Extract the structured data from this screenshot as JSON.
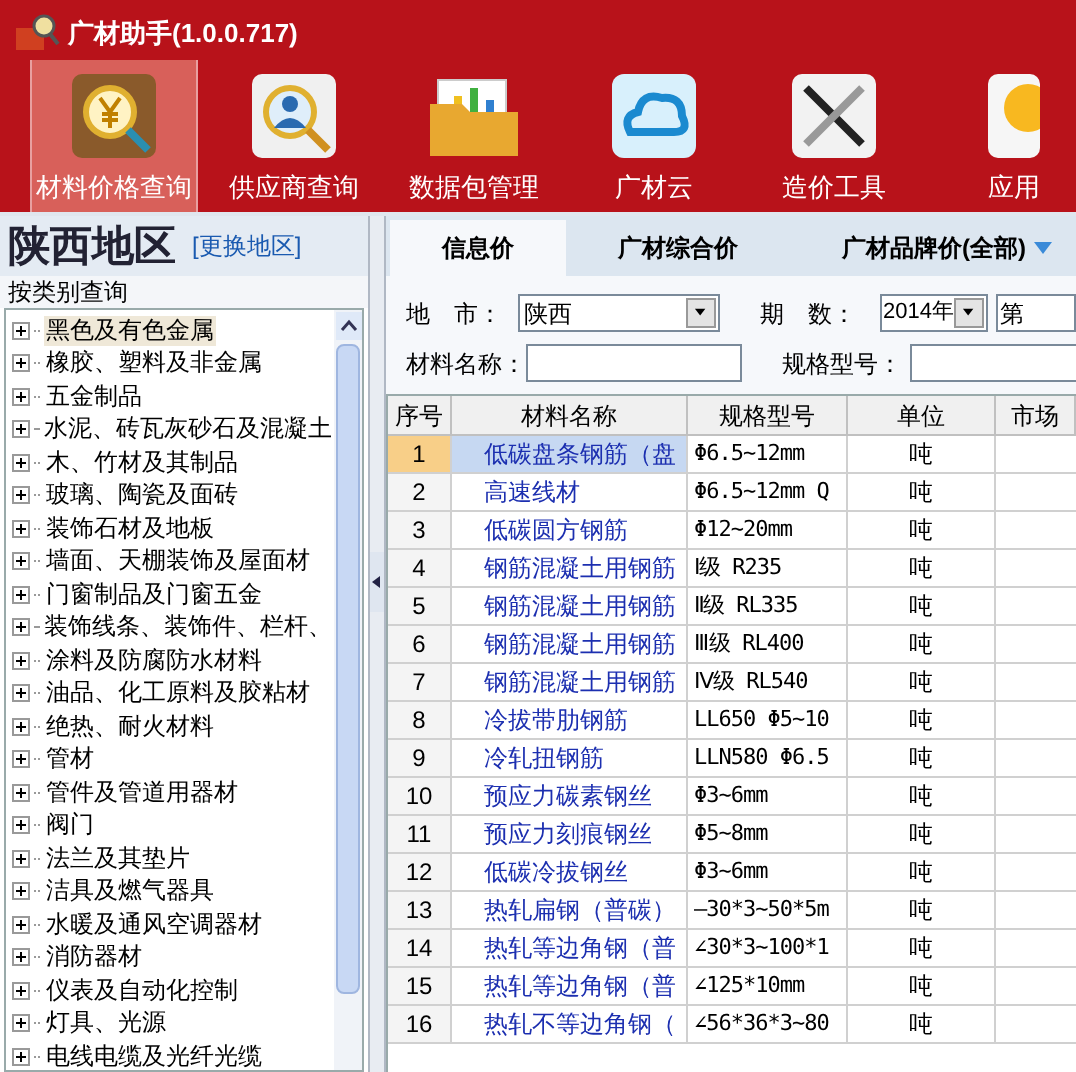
{
  "window": {
    "title": "广材助手(1.0.0.717)"
  },
  "toolbar": [
    {
      "label": "材料价格查询",
      "kind": "price",
      "selected": true
    },
    {
      "label": "供应商查询",
      "kind": "supplier",
      "selected": false
    },
    {
      "label": "数据包管理",
      "kind": "package",
      "selected": false
    },
    {
      "label": "广材云",
      "kind": "cloud",
      "selected": false
    },
    {
      "label": "造价工具",
      "kind": "tools",
      "selected": false
    },
    {
      "label": "应用",
      "kind": "bulb",
      "selected": false
    }
  ],
  "region": {
    "name": "陕西地区",
    "change_link": "[更换地区]"
  },
  "category_panel": {
    "title": "按类别查询",
    "items": [
      {
        "label": "黑色及有色金属",
        "expanded": false,
        "selected": true
      },
      {
        "label": "橡胶、塑料及非金属",
        "expanded": false,
        "selected": false
      },
      {
        "label": "五金制品",
        "expanded": false,
        "selected": false
      },
      {
        "label": "水泥、砖瓦灰砂石及混凝土",
        "expanded": false,
        "selected": false
      },
      {
        "label": "木、竹材及其制品",
        "expanded": false,
        "selected": false
      },
      {
        "label": "玻璃、陶瓷及面砖",
        "expanded": false,
        "selected": false
      },
      {
        "label": "装饰石材及地板",
        "expanded": false,
        "selected": false
      },
      {
        "label": "墙面、天棚装饰及屋面材",
        "expanded": false,
        "selected": false
      },
      {
        "label": "门窗制品及门窗五金",
        "expanded": false,
        "selected": false
      },
      {
        "label": "装饰线条、装饰件、栏杆、",
        "expanded": false,
        "selected": false
      },
      {
        "label": "涂料及防腐防水材料",
        "expanded": false,
        "selected": false
      },
      {
        "label": "油品、化工原料及胶粘材",
        "expanded": false,
        "selected": false
      },
      {
        "label": "绝热、耐火材料",
        "expanded": false,
        "selected": false
      },
      {
        "label": "管材",
        "expanded": false,
        "selected": false
      },
      {
        "label": "管件及管道用器材",
        "expanded": false,
        "selected": false
      },
      {
        "label": "阀门",
        "expanded": false,
        "selected": false
      },
      {
        "label": "法兰及其垫片",
        "expanded": false,
        "selected": false
      },
      {
        "label": "洁具及燃气器具",
        "expanded": false,
        "selected": false
      },
      {
        "label": "水暖及通风空调器材",
        "expanded": false,
        "selected": false
      },
      {
        "label": "消防器材",
        "expanded": false,
        "selected": false
      },
      {
        "label": "仪表及自动化控制",
        "expanded": false,
        "selected": false
      },
      {
        "label": "灯具、光源",
        "expanded": false,
        "selected": false
      },
      {
        "label": "电线电缆及光纤光缆",
        "expanded": false,
        "selected": false
      }
    ]
  },
  "tabs": [
    {
      "label": "信息价",
      "selected": true,
      "has_menu": false
    },
    {
      "label": "广材综合价",
      "selected": false,
      "has_menu": false
    },
    {
      "label": "广材品牌价(全部)",
      "selected": false,
      "has_menu": true
    }
  ],
  "filters": {
    "city": {
      "label": "地　市：",
      "value": "陕西"
    },
    "period": {
      "label": "期　数：",
      "year": "2014年",
      "issue": "第"
    },
    "material_name": {
      "label": "材料名称："
    },
    "spec": {
      "label": "规格型号："
    }
  },
  "table": {
    "columns": [
      "序号",
      "材料名称",
      "规格型号",
      "单位",
      "市场"
    ],
    "rows": [
      {
        "cells": [
          "1",
          "低碳盘条钢筋（盘",
          "Φ6.5~12mm",
          "吨"
        ],
        "selected": true
      },
      {
        "cells": [
          "2",
          "高速线材",
          "Φ6.5~12mm Q",
          "吨"
        ],
        "selected": false
      },
      {
        "cells": [
          "3",
          "低碳圆方钢筋",
          "Φ12~20mm",
          "吨"
        ],
        "selected": false
      },
      {
        "cells": [
          "4",
          "钢筋混凝土用钢筋",
          "Ⅰ级 R235",
          "吨"
        ],
        "selected": false
      },
      {
        "cells": [
          "5",
          "钢筋混凝土用钢筋",
          "Ⅱ级 RL335",
          "吨"
        ],
        "selected": false
      },
      {
        "cells": [
          "6",
          "钢筋混凝土用钢筋",
          "Ⅲ级 RL400",
          "吨"
        ],
        "selected": false
      },
      {
        "cells": [
          "7",
          "钢筋混凝土用钢筋",
          "Ⅳ级 RL540",
          "吨"
        ],
        "selected": false
      },
      {
        "cells": [
          "8",
          "冷拔带肋钢筋",
          "LL650 Φ5~10",
          "吨"
        ],
        "selected": false
      },
      {
        "cells": [
          "9",
          "冷轧扭钢筋",
          "LLN580 Φ6.5",
          "吨"
        ],
        "selected": false
      },
      {
        "cells": [
          "10",
          "预应力碳素钢丝",
          "Φ3~6mm",
          "吨"
        ],
        "selected": false
      },
      {
        "cells": [
          "11",
          "预应力刻痕钢丝",
          "Φ5~8mm",
          "吨"
        ],
        "selected": false
      },
      {
        "cells": [
          "12",
          "低碳冷拔钢丝",
          "Φ3~6mm",
          "吨"
        ],
        "selected": false
      },
      {
        "cells": [
          "13",
          "热轧扁钢（普碳）",
          "—30*3~50*5m",
          "吨"
        ],
        "selected": false
      },
      {
        "cells": [
          "14",
          "热轧等边角钢（普",
          "∠30*3~100*1",
          "吨"
        ],
        "selected": false
      },
      {
        "cells": [
          "15",
          "热轧等边角钢（普",
          "∠125*10mm",
          "吨"
        ],
        "selected": false
      },
      {
        "cells": [
          "16",
          "热轧不等边角钢（",
          "∠56*36*3~80",
          "吨"
        ],
        "selected": false
      }
    ]
  }
}
